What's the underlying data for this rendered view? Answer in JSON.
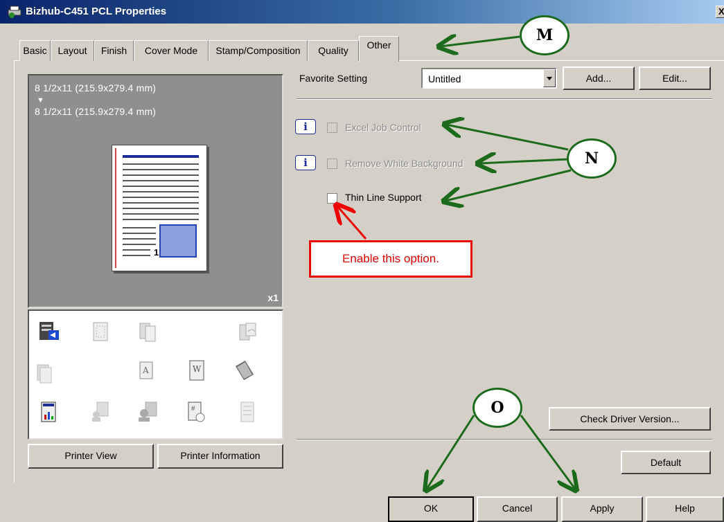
{
  "window": {
    "title": "Bizhub-C451 PCL Properties",
    "close_glyph": "X"
  },
  "tabs": [
    {
      "label": "Basic"
    },
    {
      "label": "Layout"
    },
    {
      "label": "Finish"
    },
    {
      "label": "Cover Mode"
    },
    {
      "label": "Stamp/Composition"
    },
    {
      "label": "Quality"
    },
    {
      "label": "Other",
      "active": true
    }
  ],
  "preview": {
    "original_size": "8 1/2x11 (215.9x279.4 mm)",
    "arrow": "▼",
    "output_size": "8 1/2x11 (215.9x279.4 mm)",
    "page_number": "1",
    "copies": "x1"
  },
  "left_buttons": {
    "printer_view": "Printer View",
    "printer_information": "Printer Information"
  },
  "favorite": {
    "label": "Favorite Setting",
    "value": "Untitled",
    "add_label": "Add...",
    "edit_label": "Edit..."
  },
  "options": [
    {
      "label": "Excel Job Control",
      "enabled": false,
      "checked": false,
      "info_icon": "i"
    },
    {
      "label": "Remove White Background",
      "enabled": false,
      "checked": false,
      "info_icon": "i"
    },
    {
      "label": "Thin Line Support",
      "enabled": true,
      "checked": false
    }
  ],
  "right_buttons": {
    "check_driver_version": "Check Driver Version...",
    "default": "Default"
  },
  "footer": {
    "ok": "OK",
    "cancel": "Cancel",
    "apply": "Apply",
    "help": "Help"
  },
  "annotations": {
    "m": "M",
    "n": "N",
    "o": "O",
    "callout": "Enable this option.",
    "arrow_color": "#1c6b1c",
    "callout_color": "#e00000"
  }
}
